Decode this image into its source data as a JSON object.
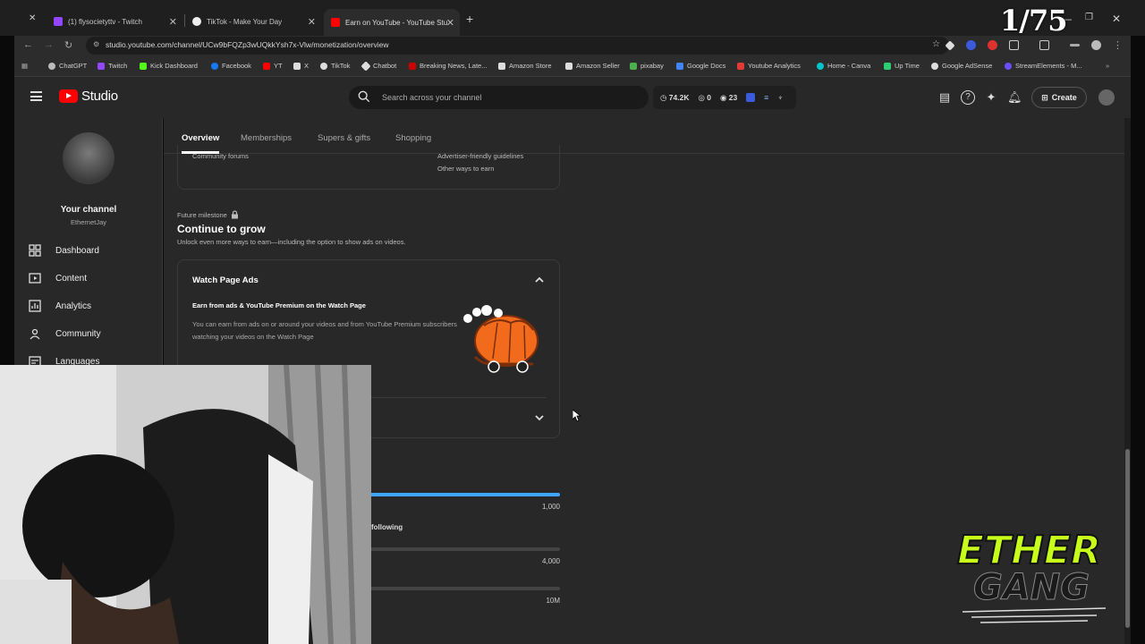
{
  "browser": {
    "tabs": [
      {
        "title": "(1) flysocietyttv - Twitch",
        "color": "#9146ff"
      },
      {
        "title": "TikTok - Make Your Day",
        "color": "#ffffff"
      },
      {
        "title": "Earn on YouTube - YouTube Stu",
        "color": "#ff0000"
      }
    ],
    "url": "studio.youtube.com/channel/UCw9bFQZp3wUQkkYsh7x-Vlw/monetization/overview",
    "bookmarks": [
      {
        "label": "ChatGPT",
        "color": "#bbbbbb"
      },
      {
        "label": "Twitch",
        "color": "#9146ff"
      },
      {
        "label": "Kick Dashboard",
        "color": "#53fc18"
      },
      {
        "label": "Facebook",
        "color": "#1877f2"
      },
      {
        "label": "YT",
        "color": "#ff0000"
      },
      {
        "label": "X",
        "color": "#dddddd"
      },
      {
        "label": "TikTok",
        "color": "#dddddd"
      },
      {
        "label": "Chatbot",
        "color": "#dddddd"
      },
      {
        "label": "Breaking News, Late...",
        "color": "#cc0000"
      },
      {
        "label": "Amazon Store",
        "color": "#dddddd"
      },
      {
        "label": "Amazon Seller",
        "color": "#dddddd"
      },
      {
        "label": "pixabay",
        "color": "#4caf50"
      },
      {
        "label": "Google Docs",
        "color": "#4285f4"
      },
      {
        "label": "Youtube Analytics",
        "color": "#e53935"
      },
      {
        "label": "Home - Canva",
        "color": "#00c4cc"
      },
      {
        "label": "Up Time",
        "color": "#2ecc71"
      },
      {
        "label": "Google AdSense",
        "color": "#dddddd"
      },
      {
        "label": "StreamElements - M...",
        "color": "#6b4cff"
      }
    ]
  },
  "header": {
    "logo_text": "Studio",
    "search_placeholder": "Search across your channel",
    "stats": {
      "views": "74.2K",
      "subs": "0",
      "watch": "23"
    },
    "create_label": "Create"
  },
  "sidebar": {
    "channel_title": "Your channel",
    "channel_handle": "EthernetJay",
    "items": [
      {
        "label": "Dashboard",
        "icon": "dashboard-icon"
      },
      {
        "label": "Content",
        "icon": "content-icon"
      },
      {
        "label": "Analytics",
        "icon": "analytics-icon"
      },
      {
        "label": "Community",
        "icon": "community-icon"
      },
      {
        "label": "Languages",
        "icon": "languages-icon"
      }
    ]
  },
  "main": {
    "tabs": [
      "Overview",
      "Memberships",
      "Supers & gifts",
      "Shopping"
    ],
    "top_card": {
      "left_link": "Community forums",
      "right_links": [
        "Advertiser-friendly guidelines",
        "Other ways to earn"
      ]
    },
    "milestone_label": "Future milestone",
    "grow_title": "Continue to grow",
    "grow_subtitle": "Unlock even more ways to earn—including the option to show ads on videos.",
    "watch_page_ads": {
      "title": "Watch Page Ads",
      "heading": "Earn from ads & YouTube Premium on the Watch Page",
      "description": "You can earn from ads on or around your videos and from YouTube Premium subscribers watching your videos on the Watch Page"
    },
    "progress": {
      "follow_label": "following",
      "bars": [
        {
          "value_label": "1,000",
          "fill": 1.0
        },
        {
          "value_label": "4,000",
          "fill": 0.0
        },
        {
          "value_label": "10M",
          "fill": 0.0
        }
      ]
    }
  },
  "overlay": {
    "counter": "1/75",
    "brand_line1": "ETHER",
    "brand_line2": "GANG"
  },
  "colors": {
    "accent": "#3ea6ff",
    "yt_red": "#ff0000",
    "brand_green": "#c8ff1a"
  }
}
